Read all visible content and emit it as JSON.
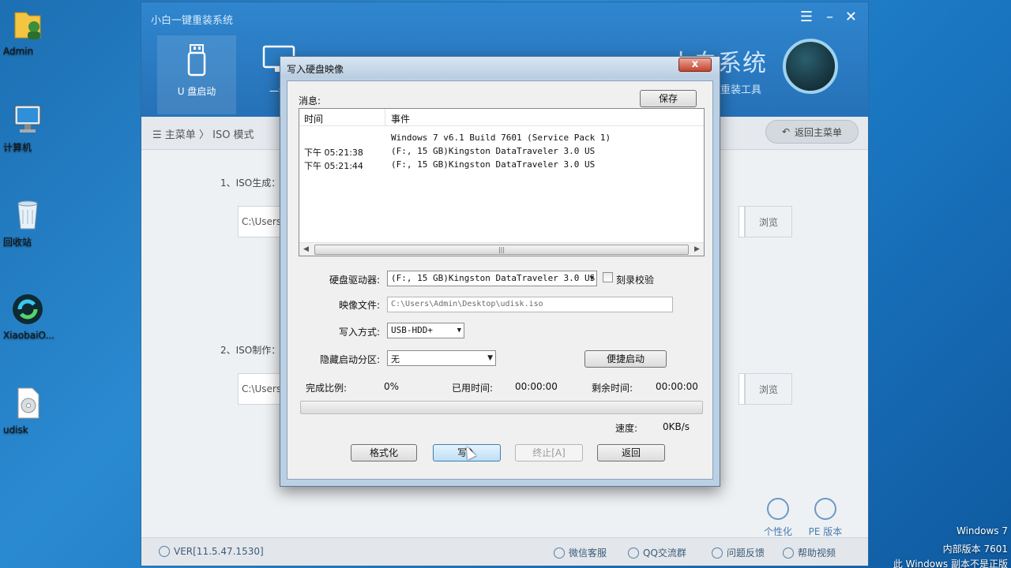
{
  "desktop": {
    "icons": [
      {
        "label": "Admin"
      },
      {
        "label": "计算机"
      },
      {
        "label": "回收站"
      },
      {
        "label": "XiaobaiO..."
      },
      {
        "label": "udisk"
      }
    ],
    "watermark": {
      "line1": "Windows 7",
      "line2": "内部版本 7601",
      "line3": "此 Windows 副本不是正版"
    }
  },
  "app": {
    "title": "小白一键重装系统",
    "tabs": [
      {
        "label": "U 盘启动"
      },
      {
        "label": "一键"
      }
    ],
    "brand": "小白系统",
    "brand_sub": "快重装工具",
    "breadcrumb": {
      "menu": "主菜单",
      "separator": "〉",
      "current": "ISO 模式"
    },
    "back_label": "返回主菜单",
    "step1": "1、ISO生成：",
    "step2": "2、ISO制作：",
    "path1": "C:\\Users",
    "path2": "C:\\Users",
    "browse_label": "浏览",
    "corner_buttons": [
      {
        "label": "个性化"
      },
      {
        "label": "PE 版本"
      }
    ],
    "footer": {
      "version": "VER[11.5.47.1530]",
      "items": [
        {
          "label": "微信客服"
        },
        {
          "label": "QQ交流群"
        },
        {
          "label": "问题反馈"
        },
        {
          "label": "帮助视频"
        }
      ]
    }
  },
  "dialog": {
    "title": "写入硬盘映像",
    "close_label": "x",
    "messages_label": "消息:",
    "save_label": "保存",
    "log": {
      "columns": [
        "时间",
        "事件"
      ],
      "rows": [
        {
          "time": "",
          "event": "Windows 7 v6.1 Build 7601 (Service Pack 1)"
        },
        {
          "time": "下午 05:21:38",
          "event": "(F:, 15 GB)Kingston DataTraveler 3.0 US"
        },
        {
          "time": "下午 05:21:44",
          "event": "(F:, 15 GB)Kingston DataTraveler 3.0 US"
        }
      ],
      "scroll_grip": "|||"
    },
    "drive_label": "硬盘驱动器:",
    "drive_value": "(F:, 15 GB)Kingston DataTraveler 3.0 US",
    "verify_label": "刻录校验",
    "verify_checked": false,
    "image_label": "映像文件:",
    "image_value": "C:\\Users\\Admin\\Desktop\\udisk.iso",
    "write_mode_label": "写入方式:",
    "write_mode_value": "USB-HDD+",
    "hidden_partition_label": "隐藏启动分区:",
    "hidden_partition_value": "无",
    "quick_boot_label": "便捷启动",
    "progress_label": "完成比例:",
    "progress_value": "0%",
    "progress_fraction": 0,
    "elapsed_label": "已用时间:",
    "elapsed_value": "00:00:00",
    "remaining_label": "剩余时间:",
    "remaining_value": "00:00:00",
    "speed_label": "速度:",
    "speed_value": "0KB/s",
    "buttons": {
      "format": "格式化",
      "write": "写入",
      "abort": "终止[A]",
      "back": "返回"
    }
  }
}
